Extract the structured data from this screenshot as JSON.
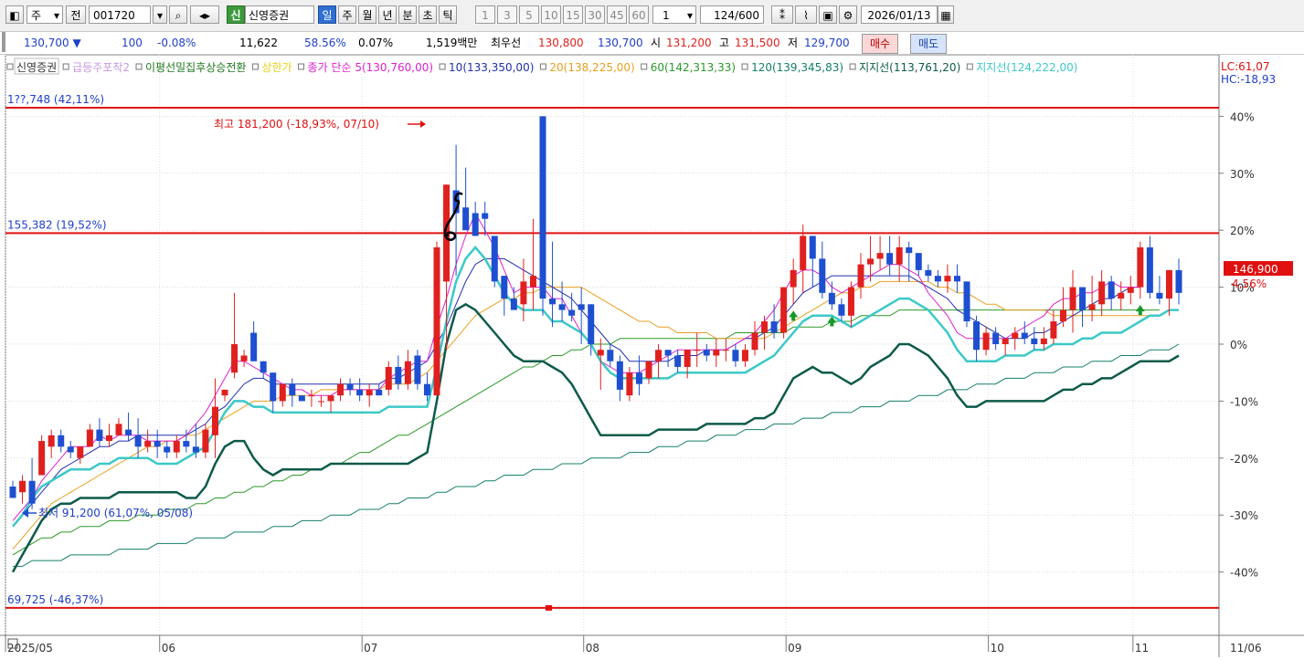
{
  "toolbar": {
    "market": "주",
    "type_btn": "전",
    "stock_code": "001720",
    "stock_badge": "신",
    "stock_name": "신영증권",
    "periods": [
      "일",
      "주",
      "월",
      "년",
      "분",
      "초",
      "틱"
    ],
    "active_period": "일",
    "intervals": [
      "1",
      "3",
      "5",
      "10",
      "15",
      "30",
      "45",
      "60"
    ],
    "interval_value": "1",
    "count": "124",
    "count_max": "/600",
    "date": "2026/01/13"
  },
  "quote": {
    "price": "130,700",
    "change_arrow": "▼",
    "change": "100",
    "change_pct": "-0.08%",
    "volume": "11,622",
    "vol_ratio": "58.56%",
    "turnover": "0.07%",
    "amount": "1,519백만",
    "best_bid_label": "최우선",
    "best_ask": "130,800",
    "best_bid": "130,700",
    "open_label": "시",
    "open": "131,200",
    "high_label": "고",
    "high": "131,500",
    "low_label": "저",
    "low": "129,700",
    "buy_btn": "매수",
    "sell_btn": "매도"
  },
  "legend": [
    {
      "text": "신영증권",
      "color": "#333333"
    },
    {
      "text": "급등주포착2",
      "color": "#c79ae0"
    },
    {
      "text": "이평선밀집후상승전환",
      "color": "#1f7a1f"
    },
    {
      "text": "상한가",
      "color": "#e6d21a"
    },
    {
      "text": "종가 단순 5(130,760,00)",
      "color": "#e020d0"
    },
    {
      "text": "10(133,350,00)",
      "color": "#2030b0"
    },
    {
      "text": "20(138,225,00)",
      "color": "#e8a020"
    },
    {
      "text": "60(142,313,33)",
      "color": "#2a9a2a"
    },
    {
      "text": "120(139,345,83)",
      "color": "#14806a"
    },
    {
      "text": "지지선(113,761,20)",
      "color": "#0d5a4a"
    },
    {
      "text": "지지선(124,222,00)",
      "color": "#3cc8c8"
    }
  ],
  "lc_hc": {
    "lc": "LC:61,07",
    "hc": "HC:-18,93"
  },
  "price_label": {
    "value": "146,900",
    "pct": "4,56%"
  },
  "chart_data": {
    "type": "candlestick",
    "y_axis_pct_ticks": [
      "40%",
      "30%",
      "20%",
      "10%",
      "0%",
      "-10%",
      "-20%",
      "-30%",
      "-40%"
    ],
    "y_ticks": [
      40,
      30,
      20,
      10,
      0,
      -10,
      -20,
      -30,
      -40
    ],
    "x_labels": [
      "2025/05",
      "06",
      "07",
      "08",
      "09",
      "10",
      "11",
      "11/06"
    ],
    "annotations": {
      "high": "최고 181,200 (-18,93%, 07/10)",
      "low": "최저 91,200 (61,07%, 05/08)",
      "line1_label": "1??,748 (42,11%)",
      "line2_label": "155,382 (19,52%)",
      "line3_label": "69,725 (-46,37%)",
      "line1_pct": 41.5,
      "line2_pct": 19.5,
      "line3_pct": -46.3
    },
    "ohlc": [
      [
        -25,
        -24,
        -27,
        -27
      ],
      [
        -26,
        -23,
        -28,
        -24
      ],
      [
        -24,
        -20,
        -29,
        -28
      ],
      [
        -23,
        -16,
        -23,
        -17
      ],
      [
        -18,
        -15,
        -20,
        -16
      ],
      [
        -16,
        -15,
        -19,
        -18
      ],
      [
        -18,
        -17,
        -20,
        -19
      ],
      [
        -20,
        -18,
        -21,
        -18
      ],
      [
        -18,
        -14,
        -18,
        -15
      ],
      [
        -15,
        -13,
        -18,
        -17
      ],
      [
        -17,
        -14,
        -18,
        -16
      ],
      [
        -16,
        -13,
        -16,
        -14
      ],
      [
        -15,
        -12,
        -17,
        -16
      ],
      [
        -16,
        -13,
        -20,
        -18
      ],
      [
        -18,
        -15,
        -19,
        -17
      ],
      [
        -17,
        -15,
        -20,
        -18
      ],
      [
        -18,
        -17,
        -20,
        -19
      ],
      [
        -19,
        -16,
        -20,
        -17
      ],
      [
        -17,
        -15,
        -19,
        -18
      ],
      [
        -18,
        -14,
        -20,
        -19
      ],
      [
        -19,
        -14,
        -20,
        -15
      ],
      [
        -16,
        -6,
        -20,
        -11
      ],
      [
        -9,
        -8,
        -10,
        -8
      ],
      [
        -5,
        9,
        -6,
        0
      ],
      [
        -3,
        -1,
        -4,
        -2
      ],
      [
        2,
        4,
        -3,
        -3
      ],
      [
        -3,
        -3,
        -6,
        -5
      ],
      [
        -5,
        -5,
        -12,
        -10
      ],
      [
        -10,
        -7,
        -11,
        -7
      ],
      [
        -7,
        -6,
        -11,
        -9
      ],
      [
        -9,
        -9,
        -10,
        -10
      ],
      [
        -9,
        -8,
        -11,
        -9
      ],
      [
        -10,
        -9,
        -11,
        -10
      ],
      [
        -10,
        -9,
        -12,
        -9
      ],
      [
        -9,
        -6,
        -10,
        -7
      ],
      [
        -7,
        -6,
        -9,
        -8
      ],
      [
        -8,
        -6,
        -10,
        -9
      ],
      [
        -9,
        -7,
        -11,
        -8
      ],
      [
        -8,
        -7,
        -9,
        -9
      ],
      [
        -8,
        -3,
        -9,
        -4
      ],
      [
        -4,
        -2,
        -8,
        -7
      ],
      [
        -7,
        -1,
        -8,
        -3
      ],
      [
        -2,
        -1,
        -8,
        -7
      ],
      [
        -7,
        -5,
        -10,
        -9
      ],
      [
        -9,
        18,
        -9,
        17
      ],
      [
        11,
        22,
        -1,
        28
      ],
      [
        27,
        35,
        12,
        23
      ],
      [
        24,
        31,
        20,
        20
      ],
      [
        23,
        25,
        20,
        19
      ],
      [
        23,
        25,
        19,
        22
      ],
      [
        19,
        19,
        10,
        11
      ],
      [
        12,
        10,
        5,
        8
      ],
      [
        8,
        10,
        6,
        6
      ],
      [
        7,
        15,
        4,
        11
      ],
      [
        10,
        22,
        6,
        12
      ],
      [
        40,
        40,
        5,
        8
      ],
      [
        8,
        18,
        3,
        7
      ],
      [
        7,
        11,
        4,
        6
      ],
      [
        6,
        9,
        4,
        5
      ],
      [
        7,
        10,
        0,
        6
      ],
      [
        7,
        7,
        -2,
        0
      ],
      [
        -2,
        1,
        -8,
        -1
      ],
      [
        -1,
        0,
        -4,
        -3
      ],
      [
        -3,
        -2,
        -10,
        -8
      ],
      [
        -9,
        -4,
        -10,
        -5
      ],
      [
        -5,
        -2,
        -9,
        -7
      ],
      [
        -6,
        -3,
        -7,
        -3
      ],
      [
        -3,
        0,
        -6,
        -1
      ],
      [
        -1,
        -1,
        -4,
        -2
      ],
      [
        -2,
        -1,
        -5,
        -4
      ],
      [
        -4,
        -1,
        -6,
        -1
      ],
      [
        -1,
        2,
        -4,
        -1
      ],
      [
        -1,
        0,
        -3,
        -2
      ],
      [
        -2,
        1,
        -4,
        -1
      ],
      [
        -1,
        1,
        -3,
        -1
      ],
      [
        -1,
        0,
        -4,
        -3
      ],
      [
        -3,
        0,
        -4,
        -1
      ],
      [
        -1,
        4,
        -2,
        2
      ],
      [
        2,
        5,
        -1,
        4
      ],
      [
        4,
        7,
        1,
        2
      ],
      [
        2,
        10,
        1,
        10
      ],
      [
        10,
        15,
        7,
        13
      ],
      [
        13,
        21,
        9,
        19
      ],
      [
        19,
        17,
        10,
        15
      ],
      [
        15,
        18,
        8,
        9
      ],
      [
        9,
        11,
        6,
        7
      ],
      [
        7,
        8,
        4,
        5
      ],
      [
        5,
        11,
        3,
        10
      ],
      [
        10,
        16,
        8,
        14
      ],
      [
        14,
        19,
        11,
        15
      ],
      [
        15,
        19,
        13,
        16
      ],
      [
        16,
        19,
        12,
        14
      ],
      [
        14,
        19,
        11,
        17
      ],
      [
        17,
        18,
        11,
        16
      ],
      [
        16,
        16,
        12,
        13
      ],
      [
        13,
        14,
        11,
        12
      ],
      [
        12,
        13,
        10,
        11
      ],
      [
        11,
        14,
        9,
        12
      ],
      [
        12,
        14,
        9,
        11
      ],
      [
        11,
        11,
        3,
        4
      ],
      [
        4,
        5,
        -3,
        -1
      ],
      [
        -1,
        3,
        -2,
        2
      ],
      [
        2,
        3,
        -1,
        0
      ],
      [
        0,
        1,
        -2,
        1
      ],
      [
        1,
        3,
        -1,
        2
      ],
      [
        2,
        4,
        0,
        1
      ],
      [
        1,
        3,
        -1,
        0
      ],
      [
        0,
        3,
        -1,
        1
      ],
      [
        1,
        6,
        0,
        4
      ],
      [
        4,
        10,
        3,
        6
      ],
      [
        6,
        13,
        2,
        10
      ],
      [
        10,
        10,
        3,
        6
      ],
      [
        6,
        12,
        4,
        7
      ],
      [
        7,
        13,
        5,
        11
      ],
      [
        11,
        12,
        6,
        8
      ],
      [
        8,
        11,
        6,
        9
      ],
      [
        9,
        12,
        7,
        10
      ],
      [
        10,
        18,
        8,
        17
      ],
      [
        17,
        19,
        8,
        9
      ],
      [
        9,
        12,
        7,
        8
      ],
      [
        8,
        12,
        5,
        13
      ],
      [
        13,
        15,
        7,
        9
      ]
    ],
    "ma5": [
      -31,
      -29,
      -27,
      -24,
      -22,
      -20,
      -18,
      -18,
      -18,
      -16,
      -17,
      -16,
      -16,
      -16,
      -17,
      -17,
      -17,
      -17,
      -16,
      -14,
      -12,
      -9,
      -6,
      -3,
      -3,
      -4,
      -5,
      -6,
      -7,
      -8,
      -8,
      -9,
      -9,
      -9,
      -8,
      -8,
      -8,
      -8,
      -8,
      -6,
      -5,
      -4,
      -3,
      -3,
      3,
      8,
      14,
      19,
      23,
      20,
      17,
      13,
      9,
      10,
      10,
      10,
      8,
      8,
      5,
      2,
      0,
      -3,
      -4,
      -5,
      -5,
      -5,
      -4,
      -3,
      -2,
      -1,
      -1,
      -1,
      -1,
      -1,
      -1,
      0,
      1,
      2,
      4,
      6,
      9,
      12,
      13,
      13,
      12,
      10,
      9,
      10,
      11,
      12,
      13,
      14,
      14,
      13,
      12,
      9,
      7,
      5,
      2,
      1,
      1,
      1,
      1,
      1,
      2,
      3,
      4,
      5,
      7,
      8,
      8,
      9,
      9,
      10,
      11,
      10,
      10,
      10
    ],
    "ma10": [
      -32,
      -30,
      -28,
      -26,
      -24,
      -22,
      -21,
      -20,
      -19,
      -18,
      -18,
      -17,
      -17,
      -16,
      -16,
      -16,
      -16,
      -16,
      -16,
      -15,
      -14,
      -12,
      -11,
      -9,
      -7,
      -6,
      -6,
      -7,
      -7,
      -7,
      -7,
      -7,
      -7,
      -7,
      -7,
      -7,
      -7,
      -7,
      -7,
      -6,
      -6,
      -5,
      -4,
      -3,
      0,
      3,
      7,
      11,
      14,
      15,
      15,
      15,
      14,
      13,
      12,
      11,
      10,
      9,
      8,
      6,
      4,
      2,
      0,
      -1,
      -3,
      -3,
      -3,
      -3,
      -3,
      -2,
      -2,
      -2,
      -1,
      -1,
      -1,
      0,
      1,
      1,
      2,
      3,
      5,
      7,
      9,
      10,
      11,
      12,
      12,
      12,
      12,
      12,
      12,
      12,
      12,
      12,
      11,
      10,
      9,
      8,
      6,
      5,
      4,
      3,
      2,
      1,
      1,
      1,
      2,
      2,
      3,
      4,
      5,
      6,
      7,
      8,
      8,
      9,
      10,
      10
    ],
    "ma20": [
      -36,
      -34,
      -32,
      -30,
      -28,
      -27,
      -26,
      -25,
      -24,
      -23,
      -22,
      -21,
      -20,
      -19,
      -18,
      -18,
      -17,
      -17,
      -16,
      -16,
      -15,
      -14,
      -13,
      -12,
      -11,
      -10,
      -10,
      -10,
      -9,
      -9,
      -9,
      -9,
      -8,
      -8,
      -8,
      -8,
      -8,
      -8,
      -8,
      -7,
      -7,
      -7,
      -6,
      -5,
      -3,
      -1,
      1,
      3,
      5,
      6,
      7,
      8,
      8,
      9,
      9,
      10,
      10,
      10,
      10,
      10,
      9,
      8,
      7,
      6,
      5,
      4,
      4,
      3,
      3,
      2,
      2,
      2,
      2,
      1,
      1,
      1,
      1,
      1,
      1,
      2,
      3,
      4,
      5,
      6,
      7,
      8,
      9,
      9,
      10,
      10,
      11,
      11,
      11,
      11,
      11,
      11,
      10,
      10,
      9,
      9,
      8,
      7,
      7,
      6,
      6,
      6,
      6,
      6,
      5,
      5,
      5,
      5,
      5,
      5,
      5,
      5,
      5,
      5,
      5
    ],
    "ma60": [
      -37,
      -36,
      -35,
      -34,
      -34,
      -33,
      -33,
      -32,
      -32,
      -32,
      -31,
      -31,
      -31,
      -30,
      -30,
      -30,
      -29,
      -29,
      -29,
      -28,
      -28,
      -27,
      -27,
      -26,
      -26,
      -25,
      -25,
      -24,
      -24,
      -23,
      -23,
      -22,
      -22,
      -21,
      -21,
      -20,
      -19,
      -19,
      -18,
      -17,
      -16,
      -16,
      -15,
      -14,
      -13,
      -12,
      -11,
      -10,
      -9,
      -8,
      -7,
      -6,
      -5,
      -4,
      -4,
      -3,
      -2,
      -2,
      -1,
      -1,
      0,
      0,
      0,
      1,
      1,
      1,
      1,
      1,
      1,
      1,
      1,
      1,
      1,
      1,
      1,
      2,
      2,
      2,
      2,
      2,
      2,
      3,
      3,
      3,
      3,
      4,
      4,
      4,
      5,
      5,
      5,
      5,
      6,
      6,
      6,
      6,
      6,
      6,
      6,
      6,
      6,
      6,
      6,
      6,
      6,
      6,
      6,
      6,
      6,
      6,
      6,
      6,
      6,
      6,
      6,
      6,
      6,
      6,
      6,
      6
    ],
    "ma120": [
      -39,
      -39,
      -38,
      -38,
      -38,
      -38,
      -37,
      -37,
      -37,
      -37,
      -37,
      -36,
      -36,
      -36,
      -36,
      -35,
      -35,
      -35,
      -35,
      -34,
      -34,
      -34,
      -34,
      -33,
      -33,
      -33,
      -33,
      -32,
      -32,
      -32,
      -31,
      -31,
      -31,
      -30,
      -30,
      -30,
      -29,
      -29,
      -29,
      -28,
      -28,
      -27,
      -27,
      -27,
      -26,
      -26,
      -25,
      -25,
      -25,
      -24,
      -24,
      -23,
      -23,
      -23,
      -22,
      -22,
      -22,
      -21,
      -21,
      -21,
      -20,
      -20,
      -20,
      -20,
      -19,
      -19,
      -19,
      -18,
      -18,
      -18,
      -17,
      -17,
      -17,
      -16,
      -16,
      -16,
      -15,
      -15,
      -15,
      -14,
      -14,
      -14,
      -13,
      -13,
      -13,
      -12,
      -12,
      -12,
      -11,
      -11,
      -11,
      -10,
      -10,
      -10,
      -9,
      -9,
      -9,
      -8,
      -8,
      -8,
      -7,
      -7,
      -7,
      -6,
      -6,
      -6,
      -5,
      -5,
      -5,
      -4,
      -4,
      -4,
      -3,
      -3,
      -3,
      -2,
      -2,
      -2,
      -1,
      -1,
      -1,
      0
    ],
    "support1": [
      -40,
      -37,
      -34,
      -31,
      -29,
      -28,
      -28,
      -27,
      -27,
      -27,
      -27,
      -26,
      -26,
      -26,
      -26,
      -26,
      -26,
      -26,
      -27,
      -27,
      -25,
      -21,
      -18,
      -17,
      -17,
      -20,
      -22,
      -23,
      -22,
      -22,
      -22,
      -22,
      -22,
      -21,
      -21,
      -21,
      -21,
      -21,
      -21,
      -21,
      -21,
      -21,
      -20,
      -19,
      -10,
      0,
      6,
      7,
      6,
      4,
      2,
      0,
      -2,
      -3,
      -3,
      -3,
      -4,
      -5,
      -7,
      -10,
      -13,
      -16,
      -16,
      -16,
      -16,
      -16,
      -16,
      -15,
      -15,
      -15,
      -15,
      -15,
      -14,
      -14,
      -14,
      -14,
      -14,
      -13,
      -13,
      -12,
      -9,
      -6,
      -5,
      -4,
      -5,
      -5,
      -6,
      -7,
      -6,
      -4,
      -3,
      -2,
      0,
      0,
      -1,
      -2,
      -4,
      -6,
      -9,
      -11,
      -11,
      -10,
      -10,
      -10,
      -10,
      -10,
      -10,
      -10,
      -9,
      -8,
      -8,
      -7,
      -7,
      -6,
      -6,
      -5,
      -4,
      -3,
      -3,
      -3,
      -3,
      -2
    ],
    "support2": [
      -32,
      -30,
      -27,
      -25,
      -24,
      -23,
      -22,
      -22,
      -22,
      -21,
      -21,
      -20,
      -20,
      -20,
      -20,
      -21,
      -21,
      -21,
      -20,
      -19,
      -18,
      -15,
      -12,
      -10,
      -10,
      -11,
      -11,
      -12,
      -12,
      -12,
      -12,
      -12,
      -12,
      -12,
      -12,
      -12,
      -12,
      -12,
      -12,
      -11,
      -11,
      -11,
      -11,
      -11,
      -4,
      4,
      11,
      15,
      17,
      15,
      12,
      9,
      7,
      6,
      6,
      6,
      4,
      4,
      3,
      2,
      0,
      -3,
      -5,
      -6,
      -6,
      -6,
      -6,
      -6,
      -6,
      -5,
      -5,
      -5,
      -5,
      -5,
      -5,
      -5,
      -5,
      -4,
      -3,
      -2,
      0,
      2,
      4,
      5,
      5,
      5,
      4,
      3,
      4,
      5,
      6,
      7,
      8,
      8,
      7,
      6,
      4,
      2,
      -1,
      -3,
      -3,
      -3,
      -3,
      -2,
      -2,
      -2,
      -1,
      -1,
      0,
      0,
      0,
      1,
      1,
      2,
      2,
      2,
      3,
      4,
      5,
      5,
      6,
      6
    ],
    "up_arrows_at": [
      81,
      85,
      117
    ]
  }
}
